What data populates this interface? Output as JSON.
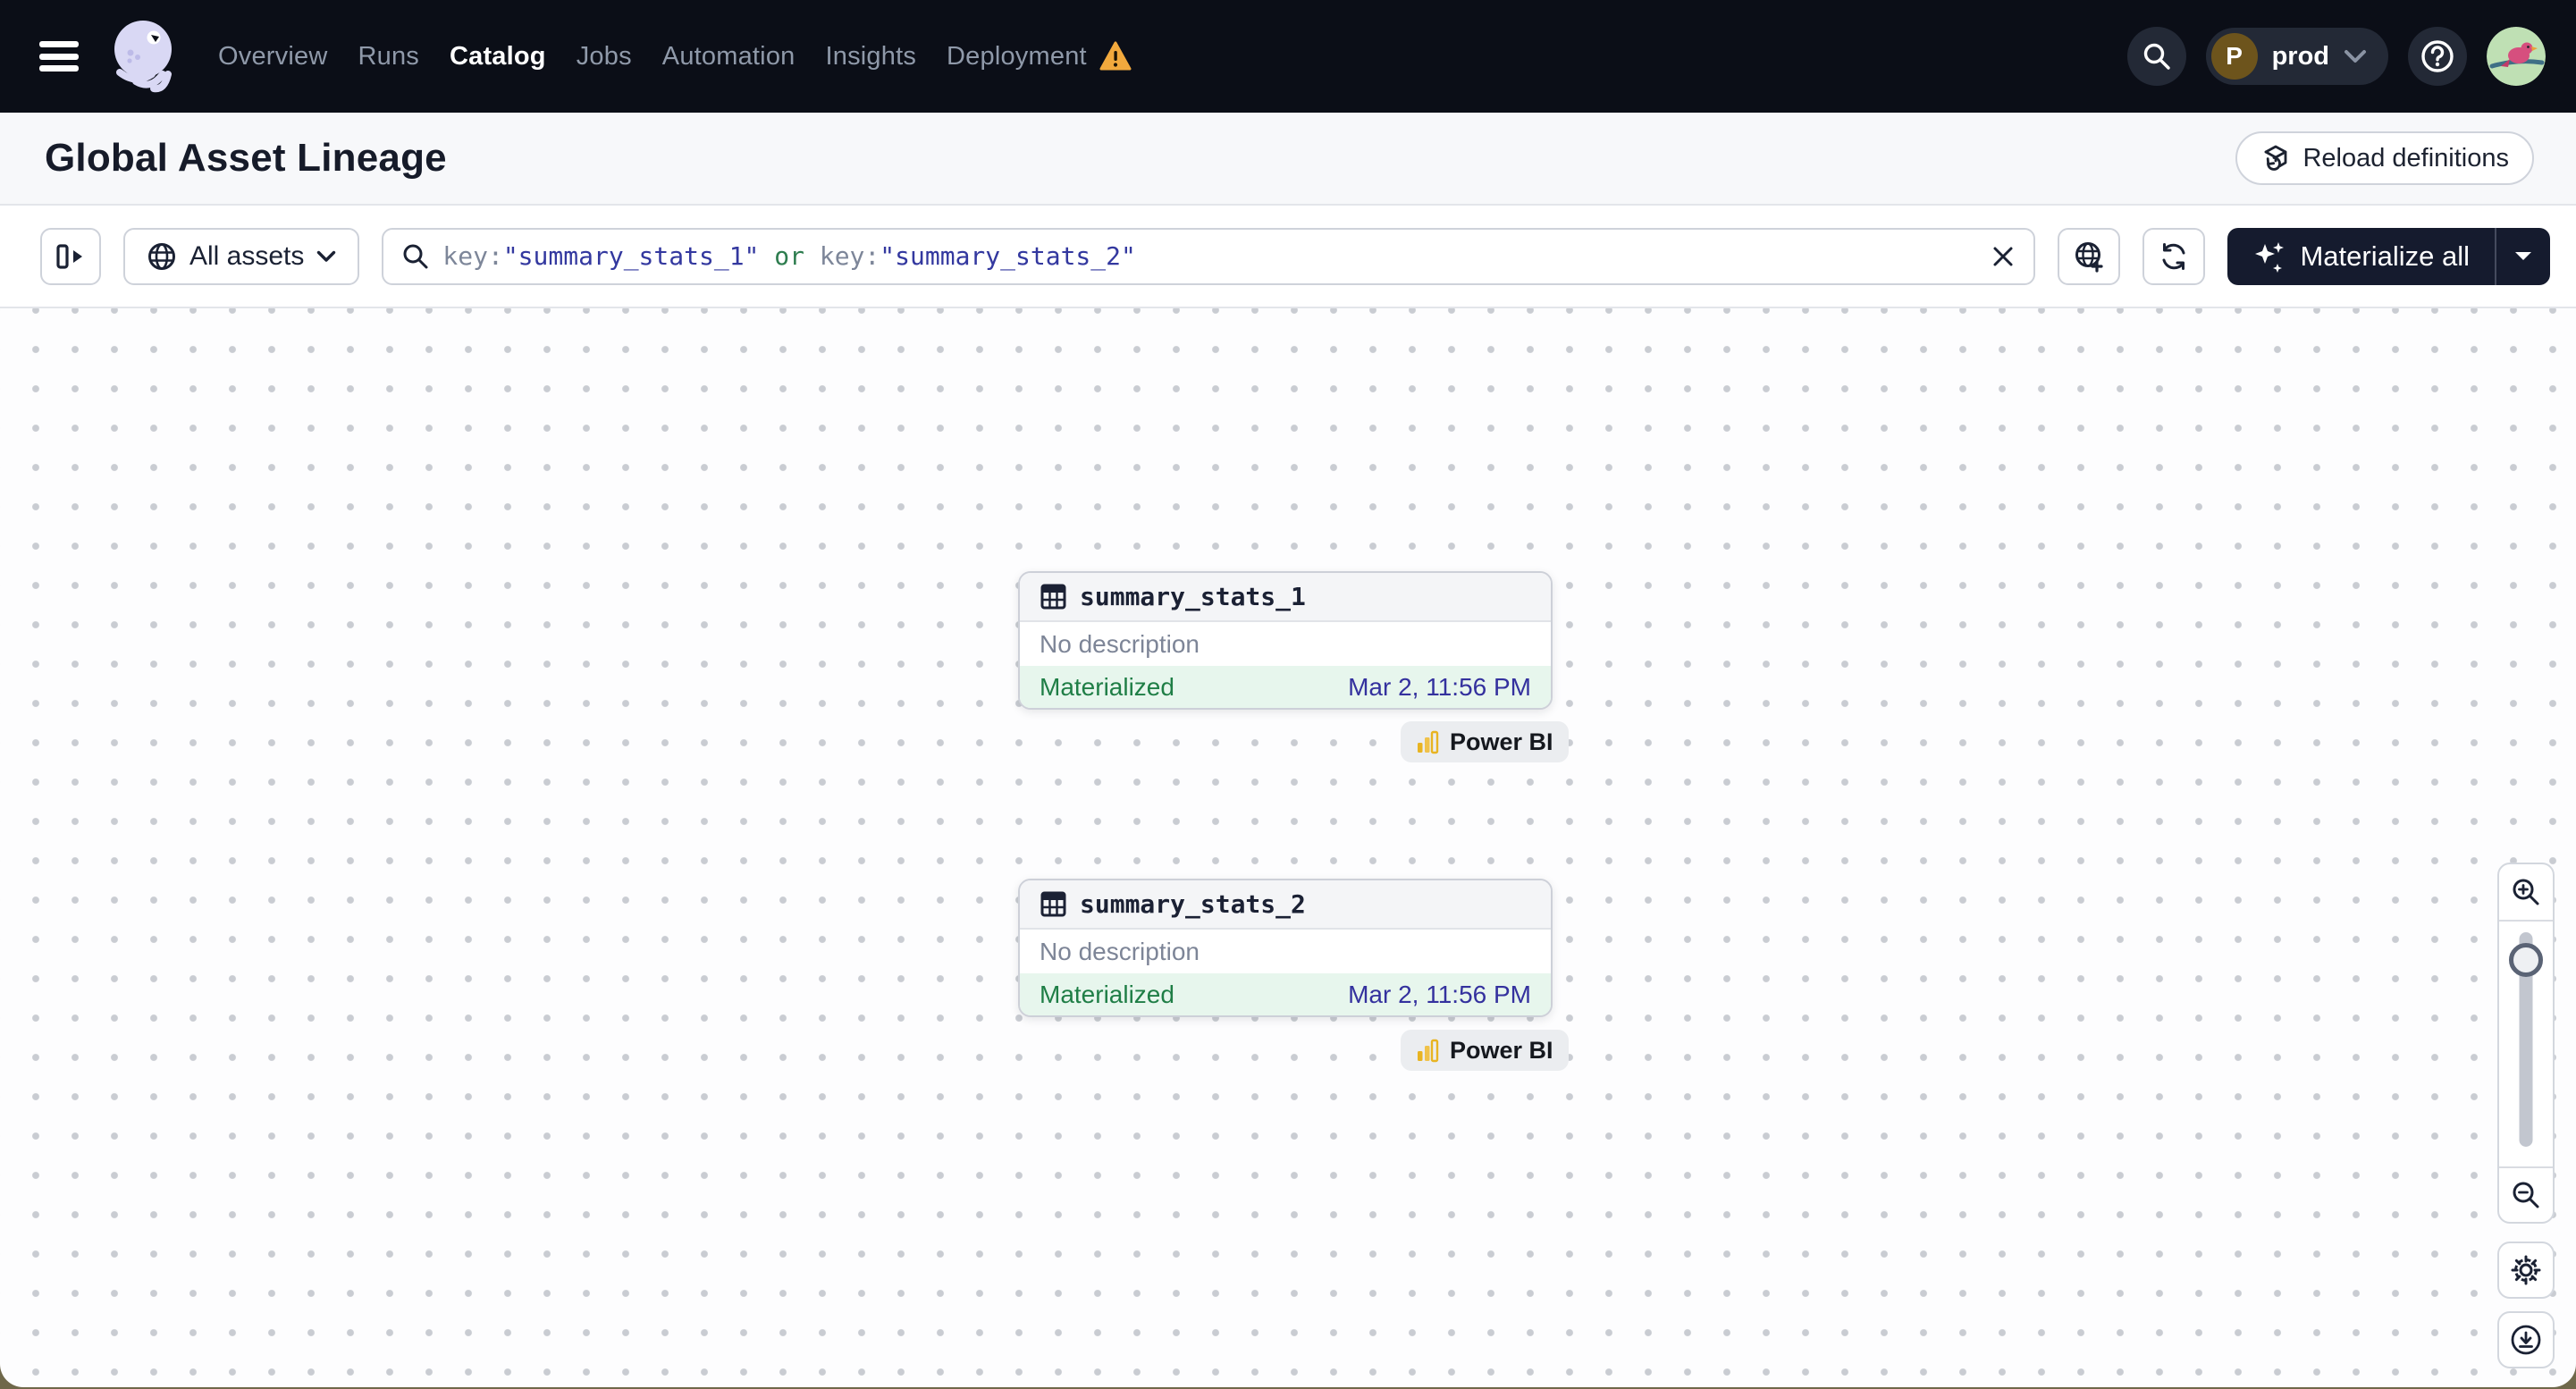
{
  "nav": {
    "items": [
      {
        "label": "Overview"
      },
      {
        "label": "Runs"
      },
      {
        "label": "Catalog"
      },
      {
        "label": "Jobs"
      },
      {
        "label": "Automation"
      },
      {
        "label": "Insights"
      },
      {
        "label": "Deployment"
      }
    ],
    "active_item": "Catalog",
    "deployment_has_warning": true,
    "workspace": {
      "initial": "P",
      "name": "prod"
    }
  },
  "header": {
    "title": "Global Asset Lineage",
    "reload_label": "Reload definitions"
  },
  "toolbar": {
    "filter_label": "All assets",
    "query": [
      {
        "text": "key:",
        "type": "key"
      },
      {
        "text": "\"summary_stats_1\"",
        "type": "value"
      },
      {
        "text": " or ",
        "type": "operator"
      },
      {
        "text": "key:",
        "type": "key"
      },
      {
        "text": "\"summary_stats_2\"",
        "type": "value"
      }
    ],
    "materialize_label": "Materialize all"
  },
  "graph": {
    "nodes": [
      {
        "title": "summary_stats_1",
        "description": "No description",
        "status": "Materialized",
        "timestamp": "Mar 2, 11:56 PM",
        "badge": "Power BI"
      },
      {
        "title": "summary_stats_2",
        "description": "No description",
        "status": "Materialized",
        "timestamp": "Mar 2, 11:56 PM",
        "badge": "Power BI"
      }
    ]
  },
  "icons": {
    "nav": [
      "hamburger-menu-icon",
      "dagster-logo",
      "warning-icon",
      "search-icon",
      "chevron-down-icon",
      "help-icon",
      "user-avatar"
    ],
    "toolbar": [
      "panel-toggle-icon",
      "globe-icon",
      "search-icon",
      "clear-icon",
      "globe-add-icon",
      "refresh-icon",
      "sparkles-icon",
      "caret-down-icon"
    ],
    "graph": [
      "table-icon",
      "power-bi-icon",
      "zoom-in-icon",
      "zoom-out-icon",
      "settings-gear-icon",
      "download-icon"
    ]
  },
  "colors": {
    "navbar_bg": "#0b0e17",
    "accent_dark_button": "#151b2e",
    "status_green_bg": "#e7f6ed",
    "status_green_text": "#1f7e46",
    "timestamp_blue": "#34319e",
    "query_value_indigo": "#33389f",
    "query_operator_green": "#2e7d4f",
    "warning_orange": "#f2a93d",
    "powerbi_yellow": "#e8b422"
  }
}
